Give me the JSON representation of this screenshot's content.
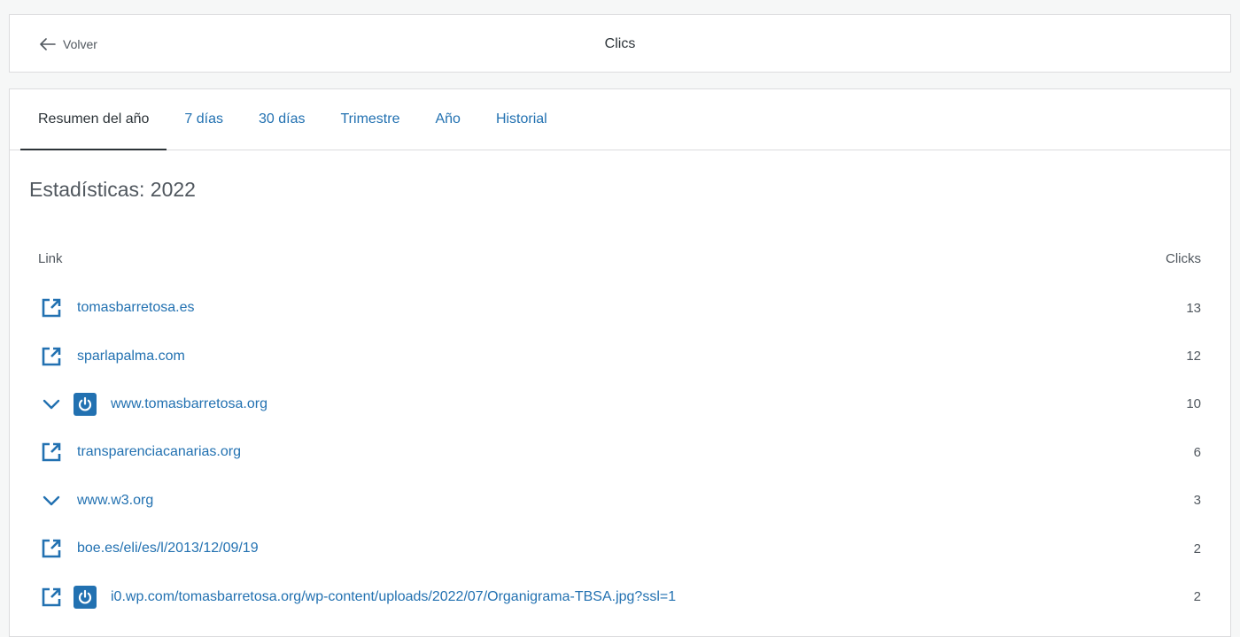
{
  "header": {
    "back_label": "Volver",
    "title": "Clics"
  },
  "tabs": [
    {
      "label": "Resumen del año",
      "active": true
    },
    {
      "label": "7 días",
      "active": false
    },
    {
      "label": "30 días",
      "active": false
    },
    {
      "label": "Trimestre",
      "active": false
    },
    {
      "label": "Año",
      "active": false
    },
    {
      "label": "Historial",
      "active": false
    }
  ],
  "section_title": "Estadísticas: 2022",
  "table": {
    "col_link": "Link",
    "col_clicks": "Clicks",
    "rows": [
      {
        "lead_icon": "external-link-icon",
        "site_icon": false,
        "link": "tomasbarretosa.es",
        "clicks": "13"
      },
      {
        "lead_icon": "external-link-icon",
        "site_icon": false,
        "link": "sparlapalma.com",
        "clicks": "12"
      },
      {
        "lead_icon": "chevron-down-icon",
        "site_icon": true,
        "link": "www.tomasbarretosa.org",
        "clicks": "10"
      },
      {
        "lead_icon": "external-link-icon",
        "site_icon": false,
        "link": "transparenciacanarias.org",
        "clicks": "6"
      },
      {
        "lead_icon": "chevron-down-icon",
        "site_icon": false,
        "link": "www.w3.org",
        "clicks": "3"
      },
      {
        "lead_icon": "external-link-icon",
        "site_icon": false,
        "link": "boe.es/eli/es/l/2013/12/09/19",
        "clicks": "2"
      },
      {
        "lead_icon": "external-link-icon",
        "site_icon": true,
        "link": "i0.wp.com/tomasbarretosa.org/wp-content/uploads/2022/07/Organigrama-TBSA.jpg?ssl=1",
        "clicks": "2"
      }
    ]
  },
  "colors": {
    "accent": "#2271b1",
    "text": "#2c3338",
    "muted": "#50575e",
    "border": "#dcdcde"
  }
}
